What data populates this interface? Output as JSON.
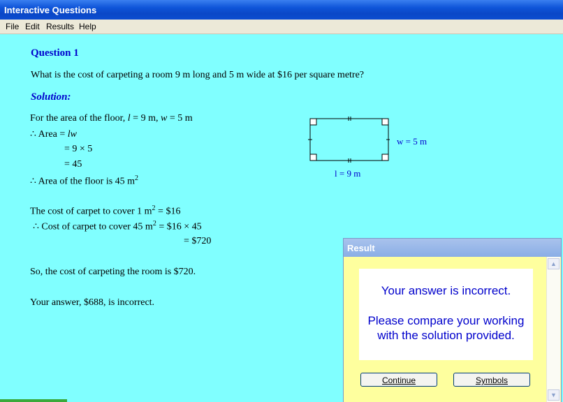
{
  "window": {
    "title": "Interactive Questions"
  },
  "menu": [
    "File",
    "Edit",
    "Results",
    "Help"
  ],
  "question": {
    "heading": "Question 1",
    "text": "What is the cost of carpeting a room 9 m long and 5 m wide at $16 per square metre?"
  },
  "solution": {
    "heading": "Solution:",
    "line1_pre": "For the area of the floor, ",
    "line1_l": "l",
    "line1_mid": " = 9 m, ",
    "line1_w": "w",
    "line1_post": " = 5 m",
    "area_pre": "∴ Area = ",
    "area_lw": "lw",
    "step1": "= 9 × 5",
    "step2": "= 45",
    "area_floor": "∴ Area of the floor is 45 m",
    "sup2": "2",
    "cost1_pre": "The cost of carpet to cover 1 m",
    "cost1_post": " = $16",
    "cost2_pre": "∴ Cost of carpet to cover 45 m",
    "cost2_post": " = $16 × 45",
    "cost_result": "= $720",
    "conclusion": "So, the cost of carpeting the room is $720.",
    "your_answer": "Your answer, $688, is incorrect."
  },
  "diagram": {
    "width_label": "w = 5 m",
    "length_label": "l = 9 m"
  },
  "dialog": {
    "title": "Result",
    "message1": "Your answer is incorrect.",
    "message2": "Please compare your working with the solution provided.",
    "continue_label": "Continue",
    "symbols_label": "Symbols"
  },
  "colors": {
    "background": "#80ffff",
    "heading": "#0000cc",
    "dialog_bg": "#feff9e"
  }
}
